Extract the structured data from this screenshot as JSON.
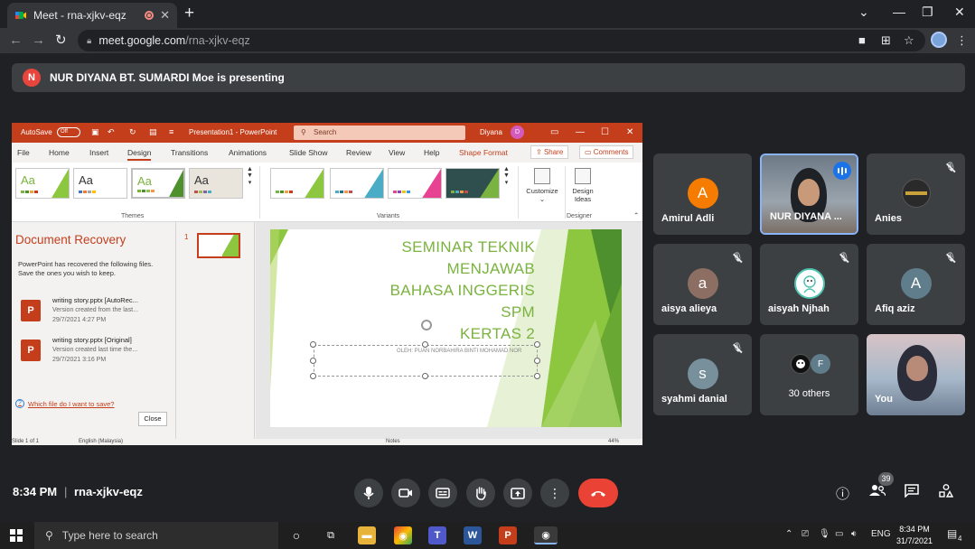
{
  "browser": {
    "tab_title": "Meet - rna-xjkv-eqz",
    "tab_close": "✕",
    "new_tab": "+",
    "url_host": "meet.google.com",
    "url_path": "/rna-xjkv-eqz"
  },
  "banner": {
    "avatar_letter": "N",
    "text": "NUR DIYANA BT. SUMARDI Moe is presenting"
  },
  "powerpoint": {
    "autosave_label": "AutoSave",
    "autosave_state": "Off",
    "file_name": "Presentation1 - PowerPoint",
    "search_placeholder": "Search",
    "user_name": "Diyana",
    "user_initial": "D",
    "tabs": [
      "File",
      "Home",
      "Insert",
      "Design",
      "Transitions",
      "Animations",
      "Slide Show",
      "Review",
      "View",
      "Help",
      "Shape Format"
    ],
    "share_label": "Share",
    "comments_label": "Comments",
    "themes_label": "Themes",
    "variants_label": "Variants",
    "designer_label": "Designer",
    "customize_label": "Customize",
    "design_ideas_label": "Design Ideas",
    "theme_sample": "Aa",
    "recovery": {
      "title": "Document Recovery",
      "description": "PowerPoint has recovered the following files.  Save the ones you wish to keep.",
      "items": [
        {
          "name": "writing story.pptx  [AutoRec...",
          "note": "Version created from the last...",
          "time": "29/7/2021 4:27 PM"
        },
        {
          "name": "writing story.pptx  [Original]",
          "note": "Version created last time the...",
          "time": "29/7/2021 3:16 PM"
        }
      ],
      "help_link": "Which file do I want to save?",
      "close_label": "Close"
    },
    "slide_number": "1",
    "slide_title_lines": [
      "SEMINAR TEKNIK",
      "MENJAWAB",
      "BAHASA INGGERIS",
      "SPM",
      "KERTAS 2"
    ],
    "slide_subtitle": "OLEH: PUAN NORBAHIRA BINTI MOHAMAD NOR",
    "status": {
      "slide_info": "Slide 1 of 1",
      "language": "English (Malaysia)",
      "notes": "Notes",
      "zoom": "44%"
    }
  },
  "participants": [
    {
      "name": "Amirul Adli",
      "letter": "A",
      "color": "#f57c00"
    },
    {
      "name": "NUR DIYANA ...",
      "letter": "",
      "color": ""
    },
    {
      "name": "Anies",
      "letter": "",
      "color": ""
    },
    {
      "name": "aisya alieya",
      "letter": "a",
      "color": "#8d6e63"
    },
    {
      "name": "aisyah Njhah",
      "letter": "",
      "color": ""
    },
    {
      "name": "Afiq aziz",
      "letter": "A",
      "color": "#607d8b"
    },
    {
      "name": "syahmi danial",
      "letter": "s",
      "color": "#78909c"
    },
    {
      "name": "30 others",
      "letter": "F",
      "color": "#607d8b"
    },
    {
      "name": "You",
      "letter": "",
      "color": ""
    }
  ],
  "bottom_bar": {
    "time": "8:34 PM",
    "separator": "|",
    "meeting_code": "rna-xjkv-eqz",
    "participant_count": "39"
  },
  "taskbar": {
    "search_placeholder": "Type here to search",
    "language": "ENG",
    "time": "8:34 PM",
    "date": "31/7/2021",
    "notification_count": "4"
  },
  "colors": {
    "meet_bg": "#202124",
    "tile_bg": "#3c4043",
    "end_call": "#ea4335",
    "ppt_accent": "#c43e1c",
    "slide_green": "#7ab33f"
  }
}
